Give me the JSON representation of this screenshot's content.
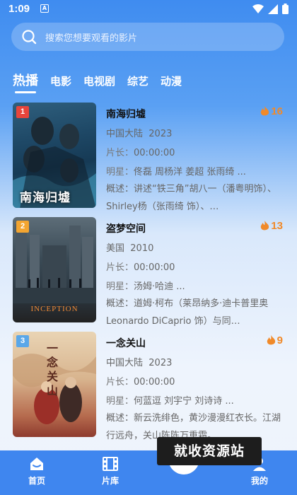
{
  "status_bar": {
    "time": "1:09",
    "notification_glyph": "A"
  },
  "search": {
    "placeholder": "搜索您想要观看的影片"
  },
  "tabs": [
    {
      "label": "热播",
      "active": true
    },
    {
      "label": "电影",
      "active": false
    },
    {
      "label": "电视剧",
      "active": false
    },
    {
      "label": "综艺",
      "active": false
    },
    {
      "label": "动漫",
      "active": false
    }
  ],
  "items": [
    {
      "rank": "1",
      "title": "南海归墟",
      "heat": "16",
      "region": "中国大陆",
      "year": "2023",
      "duration_label": "片长：",
      "duration": "00:00:00",
      "stars_label": "明星：",
      "stars": "佟磊 周杨洋 姜超 张雨绮 ...",
      "desc_label": "概述：",
      "desc": "讲述“铁三角”胡八一（潘粤明饰）、Shirley杨（张雨绮 饰）、…",
      "poster_text": "南海归墟"
    },
    {
      "rank": "2",
      "title": "盗梦空间",
      "heat": "13",
      "region": "美国",
      "year": "2010",
      "duration_label": "片长：",
      "duration": "00:00:00",
      "stars_label": "明星：",
      "stars": "汤姆·哈迪  ...",
      "desc_label": "概述：",
      "desc": "道姆·柯布（莱昂纳多·迪卡普里奥 Leonardo DiCaprio 饰）与同…",
      "poster_text": "INCEPTION"
    },
    {
      "rank": "3",
      "title": "一念关山",
      "heat": "9",
      "region": "中国大陆",
      "year": "2023",
      "duration_label": "片长：",
      "duration": "00:00:00",
      "stars_label": "明星：",
      "stars": "何蓝逗  刘宇宁  刘诗诗  ...",
      "desc_label": "概述：",
      "desc": "新云洗绯色，黄沙漫漫红衣长。江湖行远舟，关山陈陈万重霜。",
      "poster_text": "一念关山"
    }
  ],
  "watermark": "就收资源站",
  "bottom_nav": [
    {
      "label": "首页",
      "icon": "home-icon"
    },
    {
      "label": "片库",
      "icon": "film-icon"
    },
    {
      "label": "我的",
      "icon": "user-icon"
    }
  ],
  "colors": {
    "accent": "#3f86ef",
    "heat": "#f08a2a",
    "rank1": "#e8453c",
    "rank2": "#f3a531",
    "rank3": "#5aa7e8"
  }
}
